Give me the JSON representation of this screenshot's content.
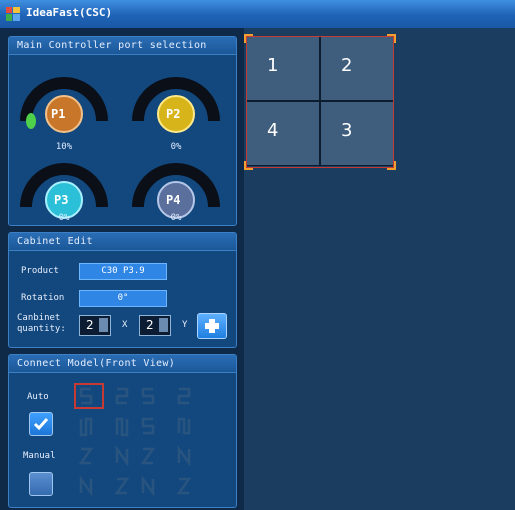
{
  "window": {
    "title": "IdeaFast(CSC)"
  },
  "ports_panel": {
    "title": "Main Controller port selection",
    "ports": [
      {
        "label": "P1",
        "percent": "10%",
        "progress": 0.1,
        "color": "#c8772a"
      },
      {
        "label": "P2",
        "percent": "0%",
        "progress": 0,
        "color": "#d7b51a"
      },
      {
        "label": "P3",
        "percent": "0%",
        "progress": 0,
        "color": "#2cc0d8"
      },
      {
        "label": "P4",
        "percent": "0%",
        "progress": 0,
        "color": "#5a6f9c"
      }
    ]
  },
  "cabinet_panel": {
    "title": "Cabinet Edit",
    "product_label": "Product",
    "product_value": "C30 P3.9",
    "rotation_label": "Rotation",
    "rotation_value": "0°",
    "quantity_label_1": "Canbinet",
    "quantity_label_2": "quantity:",
    "quantity_x": "2",
    "x_symbol": "X",
    "quantity_y": "2",
    "y_symbol": "Y"
  },
  "connect_panel": {
    "title": "Connect Model(Front View)",
    "auto_label": "Auto",
    "auto_checked": true,
    "manual_label": "Manual",
    "manual_checked": false
  },
  "canvas": {
    "cells": [
      "1",
      "2",
      "4",
      "3"
    ]
  },
  "colors": {
    "selection_border": "#c63a32",
    "corner_handle": "#f0a030",
    "accent_blue": "#2f86e4"
  }
}
